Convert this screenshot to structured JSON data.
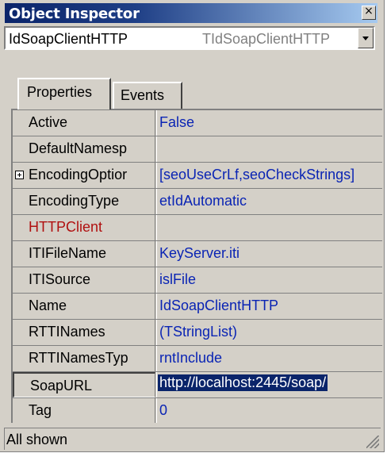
{
  "window": {
    "title": "Object Inspector",
    "close_glyph": "×"
  },
  "selector": {
    "component_name": "IdSoapClientHTTP",
    "component_type": "TIdSoapClientHTTP"
  },
  "tabs": [
    {
      "label": "Properties",
      "active": true
    },
    {
      "label": "Events",
      "active": false
    }
  ],
  "properties": [
    {
      "name": "Active",
      "value": "False"
    },
    {
      "name": "DefaultNamesp",
      "value": ""
    },
    {
      "name": "EncodingOptior",
      "value": "[seoUseCrLf,seoCheckStrings]",
      "expandable": true
    },
    {
      "name": "EncodingType",
      "value": "etIdAutomatic"
    },
    {
      "name": "HTTPClient",
      "value": "",
      "highlight": "red"
    },
    {
      "name": "ITIFileName",
      "value": "KeyServer.iti"
    },
    {
      "name": "ITISource",
      "value": "islFile"
    },
    {
      "name": "Name",
      "value": "IdSoapClientHTTP"
    },
    {
      "name": "RTTINames",
      "value": "(TStringList)"
    },
    {
      "name": "RTTINamesTyp",
      "value": "rntInclude"
    },
    {
      "name": "SoapURL",
      "value": "http://localhost:2445/soap/",
      "selected": true
    },
    {
      "name": "Tag",
      "value": "0"
    }
  ],
  "status": {
    "text": "All shown"
  },
  "colors": {
    "title_gradient_start": "#0a246a",
    "title_gradient_end": "#a6caf0",
    "value_text": "#0a24b4",
    "reference_property": "#b01010",
    "selection": "#0a246a",
    "face": "#d4d0c8"
  }
}
